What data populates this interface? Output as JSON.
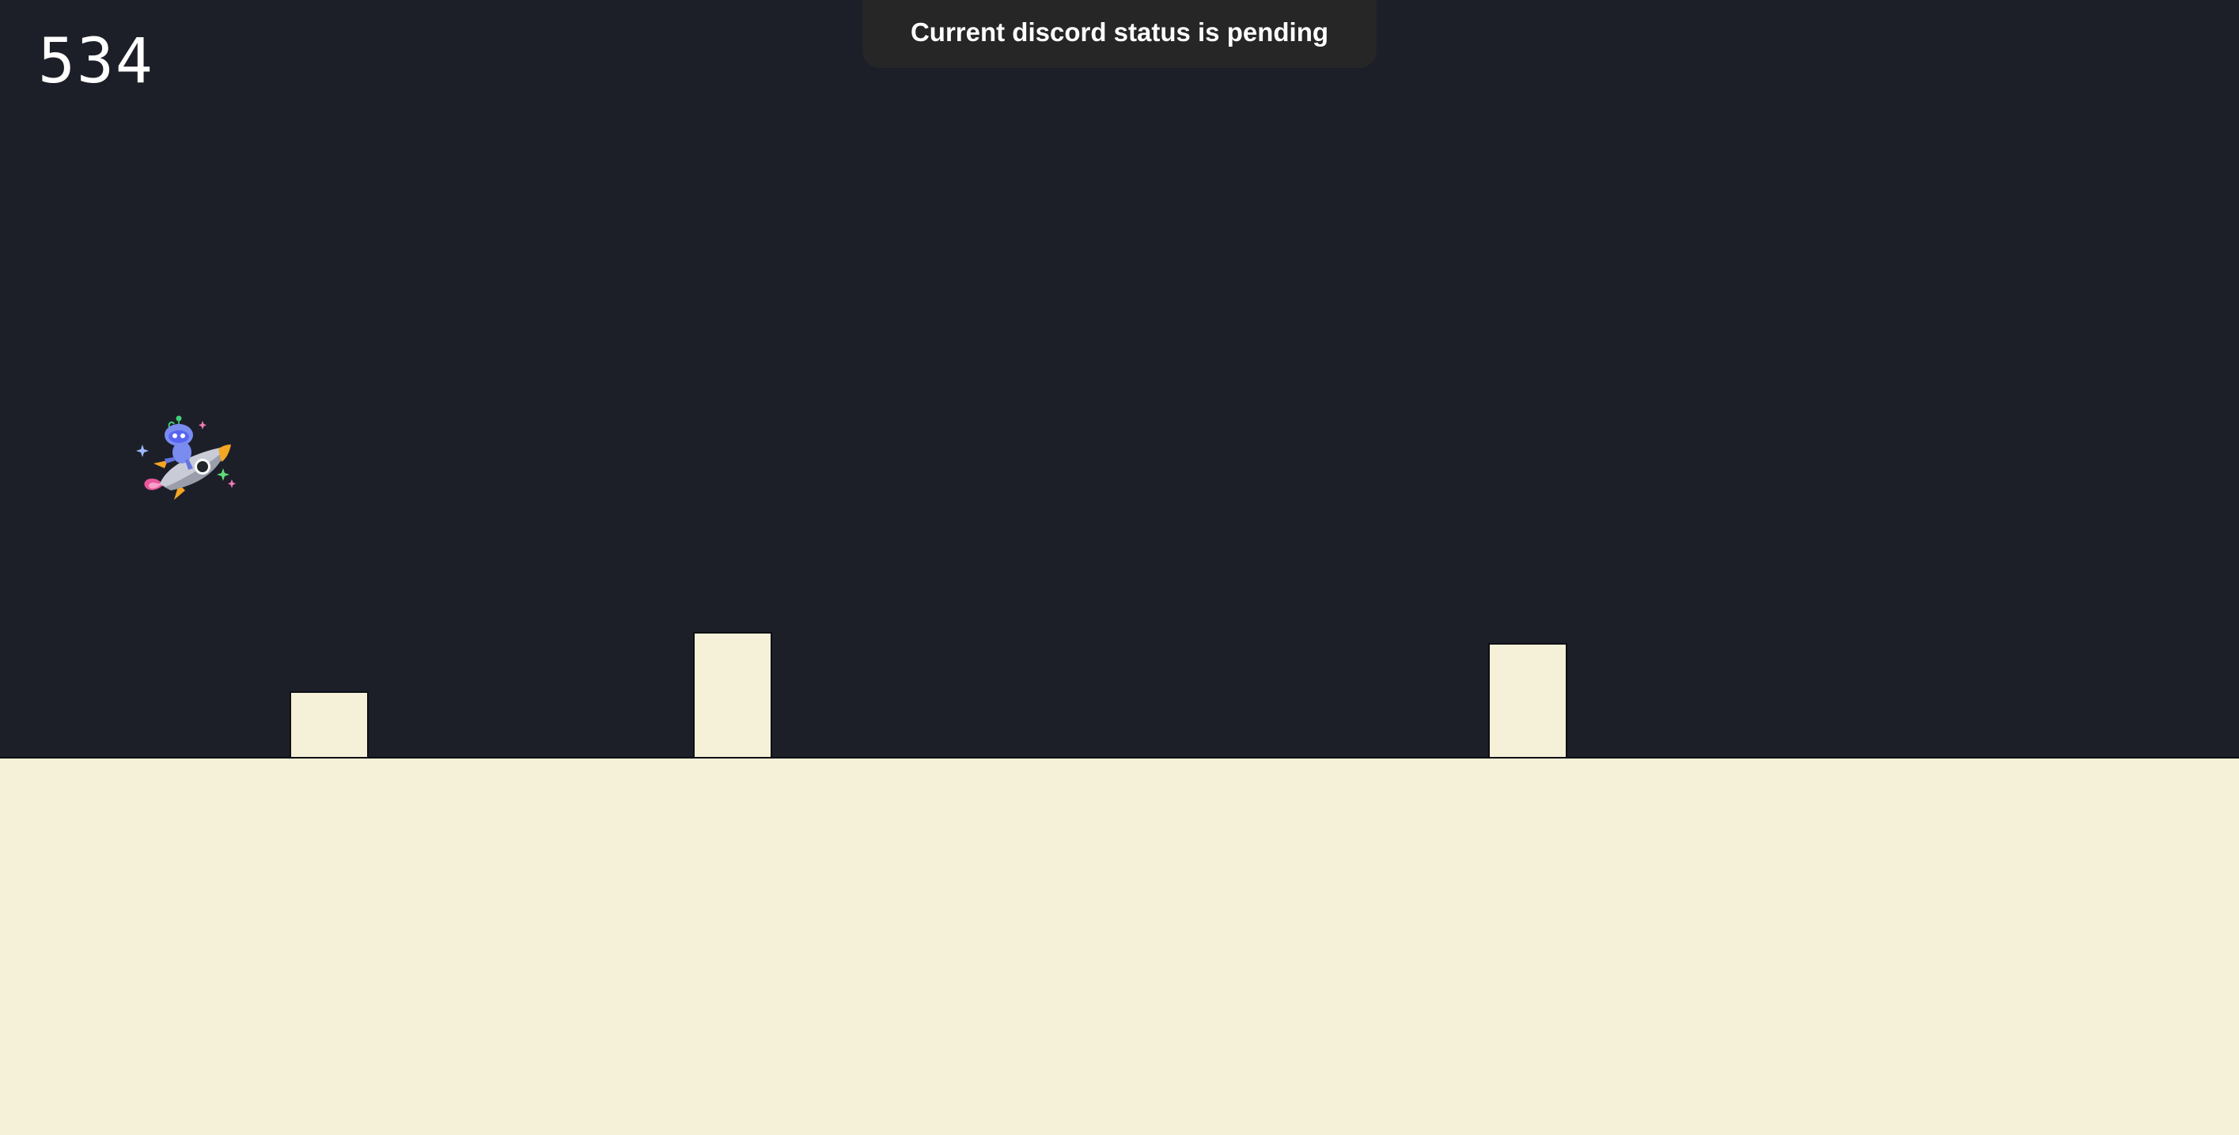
{
  "game": {
    "score": "534",
    "toast": {
      "message": "Current discord status is pending"
    },
    "player": {
      "icon": "discord-mascot-rocket-icon"
    },
    "obstacles": [
      {
        "name": "obstacle-1"
      },
      {
        "name": "obstacle-2"
      },
      {
        "name": "obstacle-3"
      }
    ],
    "colors": {
      "background": "#1c1f28",
      "ground": "#f5f0d8",
      "obstacle": "#f5f0d8",
      "toast": "#262626",
      "text": "#ffffff"
    }
  }
}
